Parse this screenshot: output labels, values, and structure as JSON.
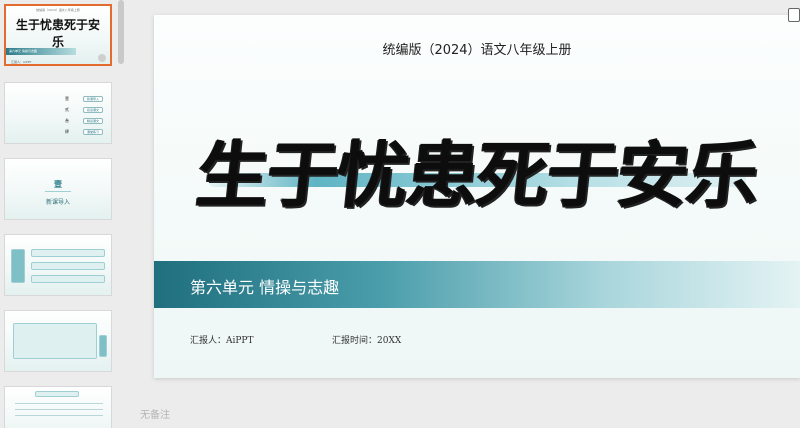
{
  "thumbnails": {
    "t1": {
      "subtitle": "统编版（2024）语文八年级上册",
      "title": "生于忧患死于安乐",
      "band": "第六单元 情操与志趣",
      "footer": "汇报人：AiPPT"
    },
    "t2": {
      "rows": [
        "壹",
        "贰",
        "叁",
        "肆"
      ],
      "chips": [
        "新课导入",
        "初读课文",
        "精读课文",
        "课堂练习"
      ]
    },
    "t3": {
      "num": "壹",
      "text": "新课导入"
    }
  },
  "slide": {
    "subtitle": "统编版（2024）语文八年级上册",
    "title": "生于忧患死于安乐",
    "unit": "第六单元 情操与志趣",
    "reporter": "汇报人：AiPPT",
    "report_time": "汇报时间：20XX"
  },
  "notes_placeholder": "无备注",
  "colors": {
    "accent": "#2a7b88",
    "selected_border": "#e46b2f"
  }
}
